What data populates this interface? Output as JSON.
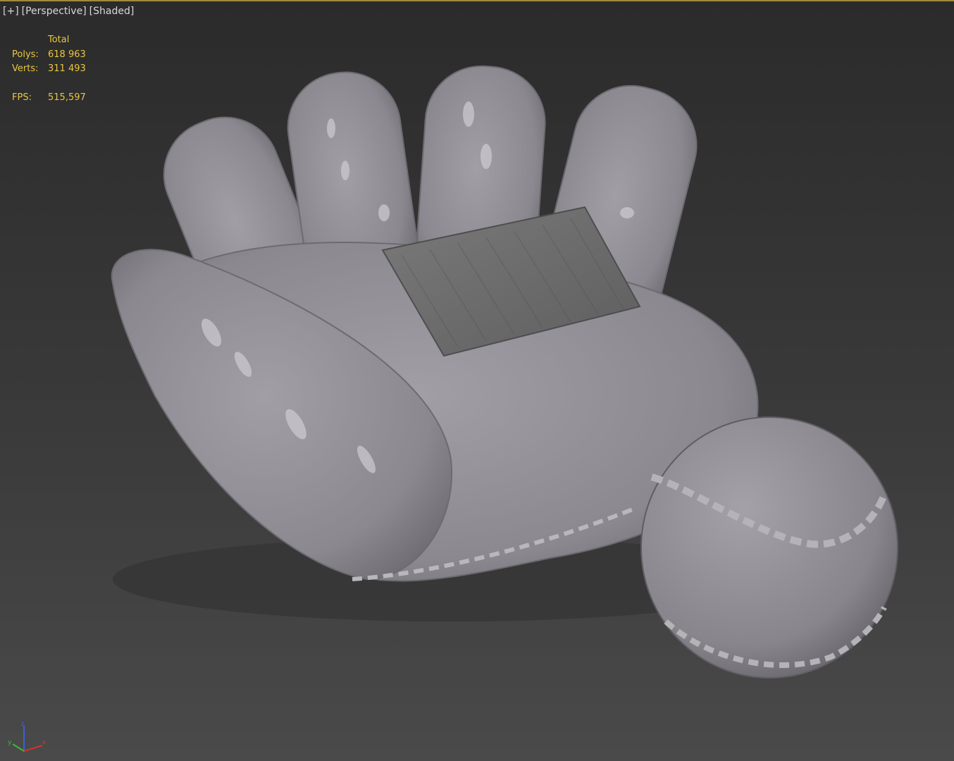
{
  "viewport": {
    "labels": [
      "[+]",
      "[Perspective]",
      "[Shaded]"
    ]
  },
  "stats": {
    "header": "Total",
    "rows": [
      {
        "label": "Polys:",
        "value": "618 963"
      },
      {
        "label": "Verts:",
        "value": "311 493"
      }
    ],
    "fps_label": "FPS:",
    "fps_value": "515,597"
  },
  "gizmo": {
    "axes": [
      "x",
      "y",
      "z"
    ],
    "colors": {
      "x": "#d43030",
      "y": "#3cb83c",
      "z": "#3a5ee0"
    }
  },
  "colors": {
    "accent_border": "#a08a3c",
    "stats_text": "#e8c640",
    "model": "#8e8b92",
    "pillow": "#6e6e6e"
  }
}
